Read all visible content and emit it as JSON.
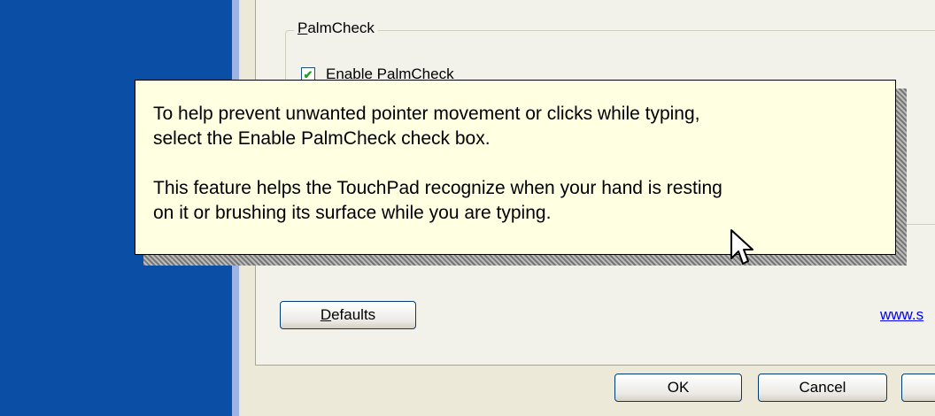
{
  "groupbox": {
    "title_hotkey": "P",
    "title_rest": "almCheck"
  },
  "checkbox": {
    "checked_glyph": "✔",
    "label_hotkey": "E",
    "label_rest": "nable PalmCheck",
    "checked": true
  },
  "tooltip": {
    "paragraph1_line1": "To help prevent unwanted pointer movement or clicks while typing,",
    "paragraph1_line2": "select the Enable PalmCheck check box.",
    "paragraph2_line1": "This feature helps the TouchPad recognize when your hand is resting",
    "paragraph2_line2": "on it or brushing its surface while you are typing."
  },
  "buttons": {
    "defaults_hotkey": "D",
    "defaults_rest": "efaults",
    "ok": "OK",
    "cancel": "Cancel"
  },
  "link": {
    "text": "www.s"
  },
  "colors": {
    "desktop_blue": "#0a4fa5",
    "dialog_bg": "#ece9d8",
    "tooltip_bg": "#ffffe1",
    "button_border": "#003c74",
    "link": "#0000ee"
  }
}
